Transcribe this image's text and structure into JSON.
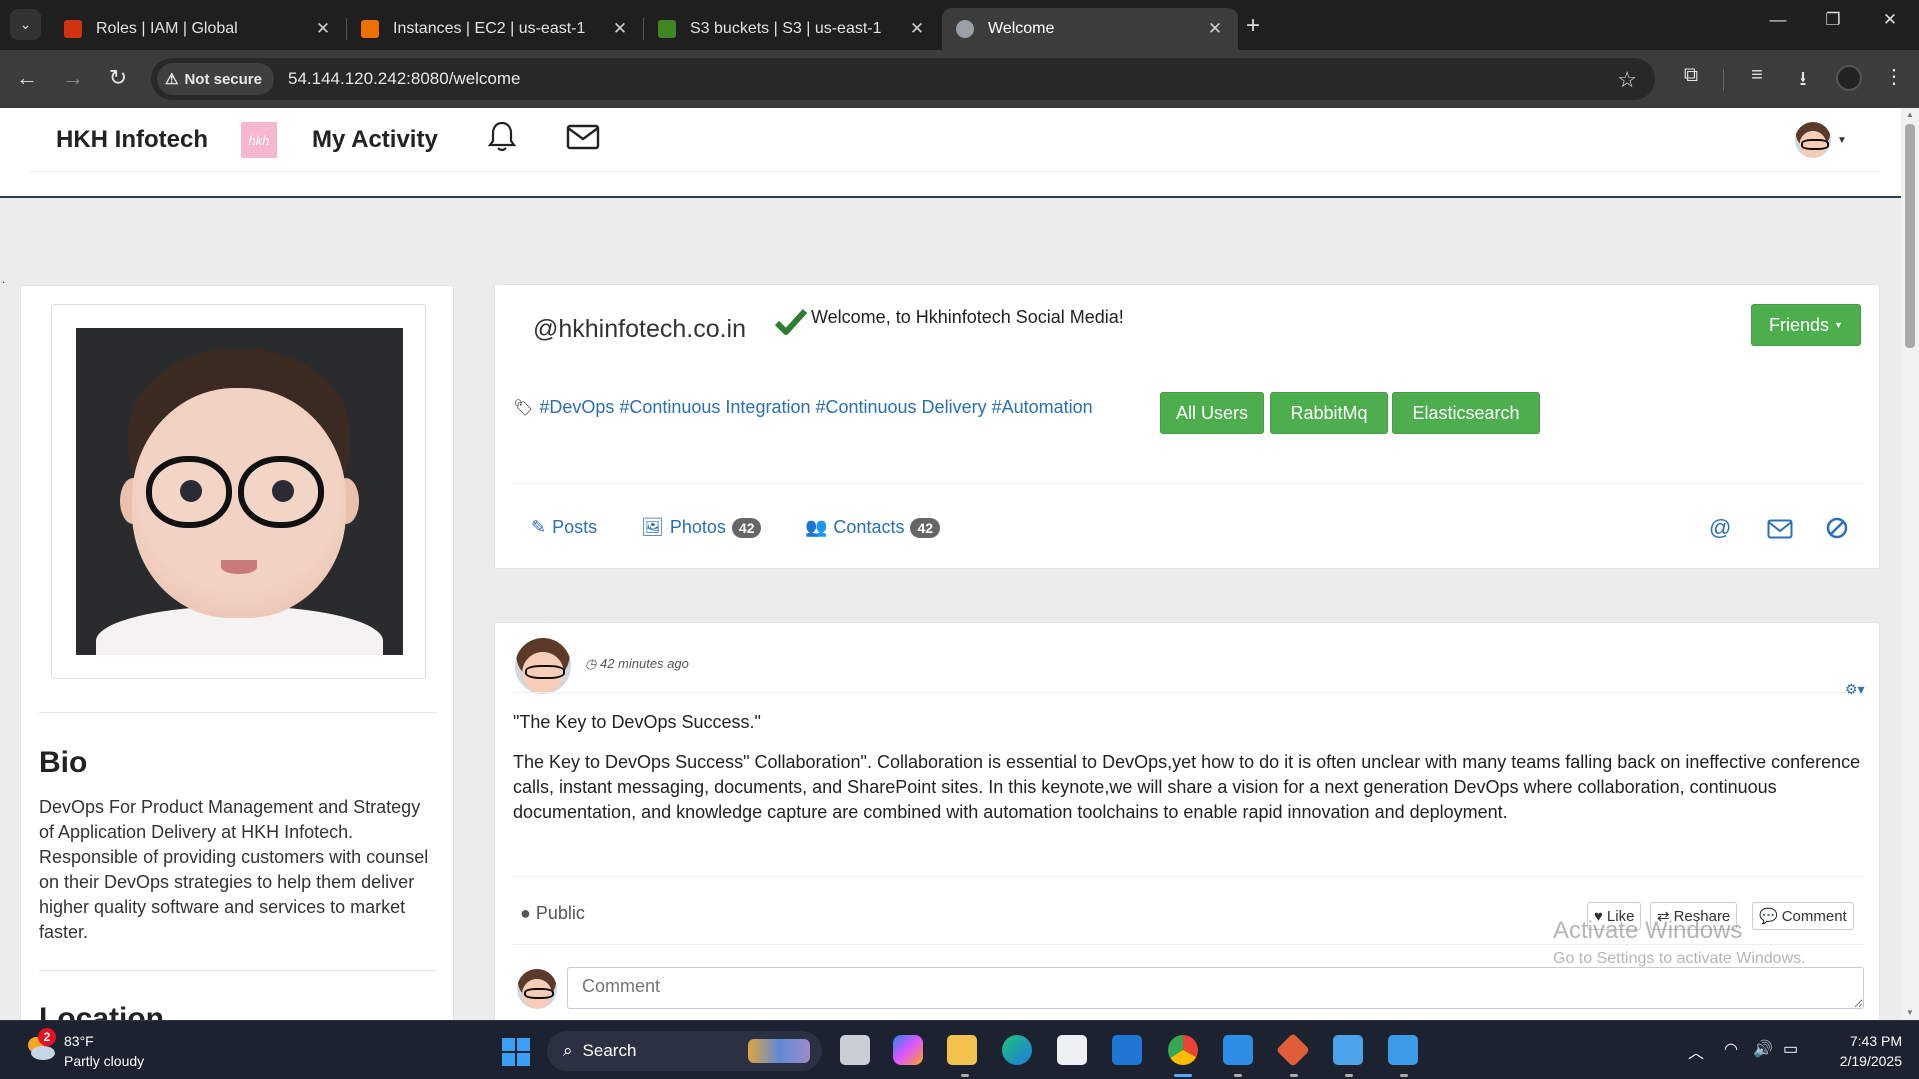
{
  "browser": {
    "tabs": [
      {
        "title": "Roles | IAM | Global",
        "favicon_color": "#d13212"
      },
      {
        "title": "Instances | EC2 | us-east-1",
        "favicon_color": "#ed7100"
      },
      {
        "title": "S3 buckets | S3 | us-east-1",
        "favicon_color": "#3f8624"
      },
      {
        "title": "Welcome",
        "favicon_color": "#9aa0a6"
      }
    ],
    "security_label": "Not secure",
    "url": "54.144.120.242:8080/welcome"
  },
  "site": {
    "brand": "HKH Infotech",
    "logo_text": "hkh",
    "nav_activity": "My Activity"
  },
  "profile": {
    "bio_title": "Bio",
    "bio_text": "DevOps For Product Management and Strategy of Application Delivery at HKH Infotech. Responsible of providing customers with counsel on their DevOps strategies to help them deliver higher quality software and services to market faster.",
    "location_title": "Location",
    "handle": "@hkhinfotech.co.in",
    "welcome": "Welcome, to Hkhinfotech Social Media!",
    "friends_button": "Friends",
    "tags": "#DevOps #Continuous Integration #Continuous Delivery #Automation",
    "tag_buttons": [
      "All Users",
      "RabbitMq",
      "Elasticsearch"
    ],
    "tabs": {
      "posts": "Posts",
      "photos": "Photos",
      "photos_count": "42",
      "contacts": "Contacts",
      "contacts_count": "42"
    }
  },
  "post": {
    "time": "42 minutes ago",
    "title": "\"The Key to DevOps Success.\"",
    "body": "The Key to DevOps Success\" Collaboration\". Collaboration is essential to DevOps,yet how to do it is often unclear with many teams falling back on ineffective conference calls, instant messaging, documents, and SharePoint sites. In this keynote,we will share a vision for a next generation DevOps where collaboration, continuous documentation, and knowledge capture are combined with automation toolchains to enable rapid innovation and deployment.",
    "visibility": "Public",
    "like": "Like",
    "reshare": "Reshare",
    "comment": "Comment",
    "comment_placeholder": "Comment"
  },
  "watermark": {
    "line1": "Activate Windows",
    "line2": "Go to Settings to activate Windows."
  },
  "taskbar": {
    "weather_badge": "2",
    "temperature": "83°F",
    "condition": "Partly cloudy",
    "search": "Search",
    "time": "7:43 PM",
    "date": "2/19/2025"
  },
  "colors": {
    "green": "#4cae4c",
    "link_blue": "#2a6fb6",
    "header_border": "#2b3d5b",
    "chrome_bg": "#1f1f1f"
  }
}
